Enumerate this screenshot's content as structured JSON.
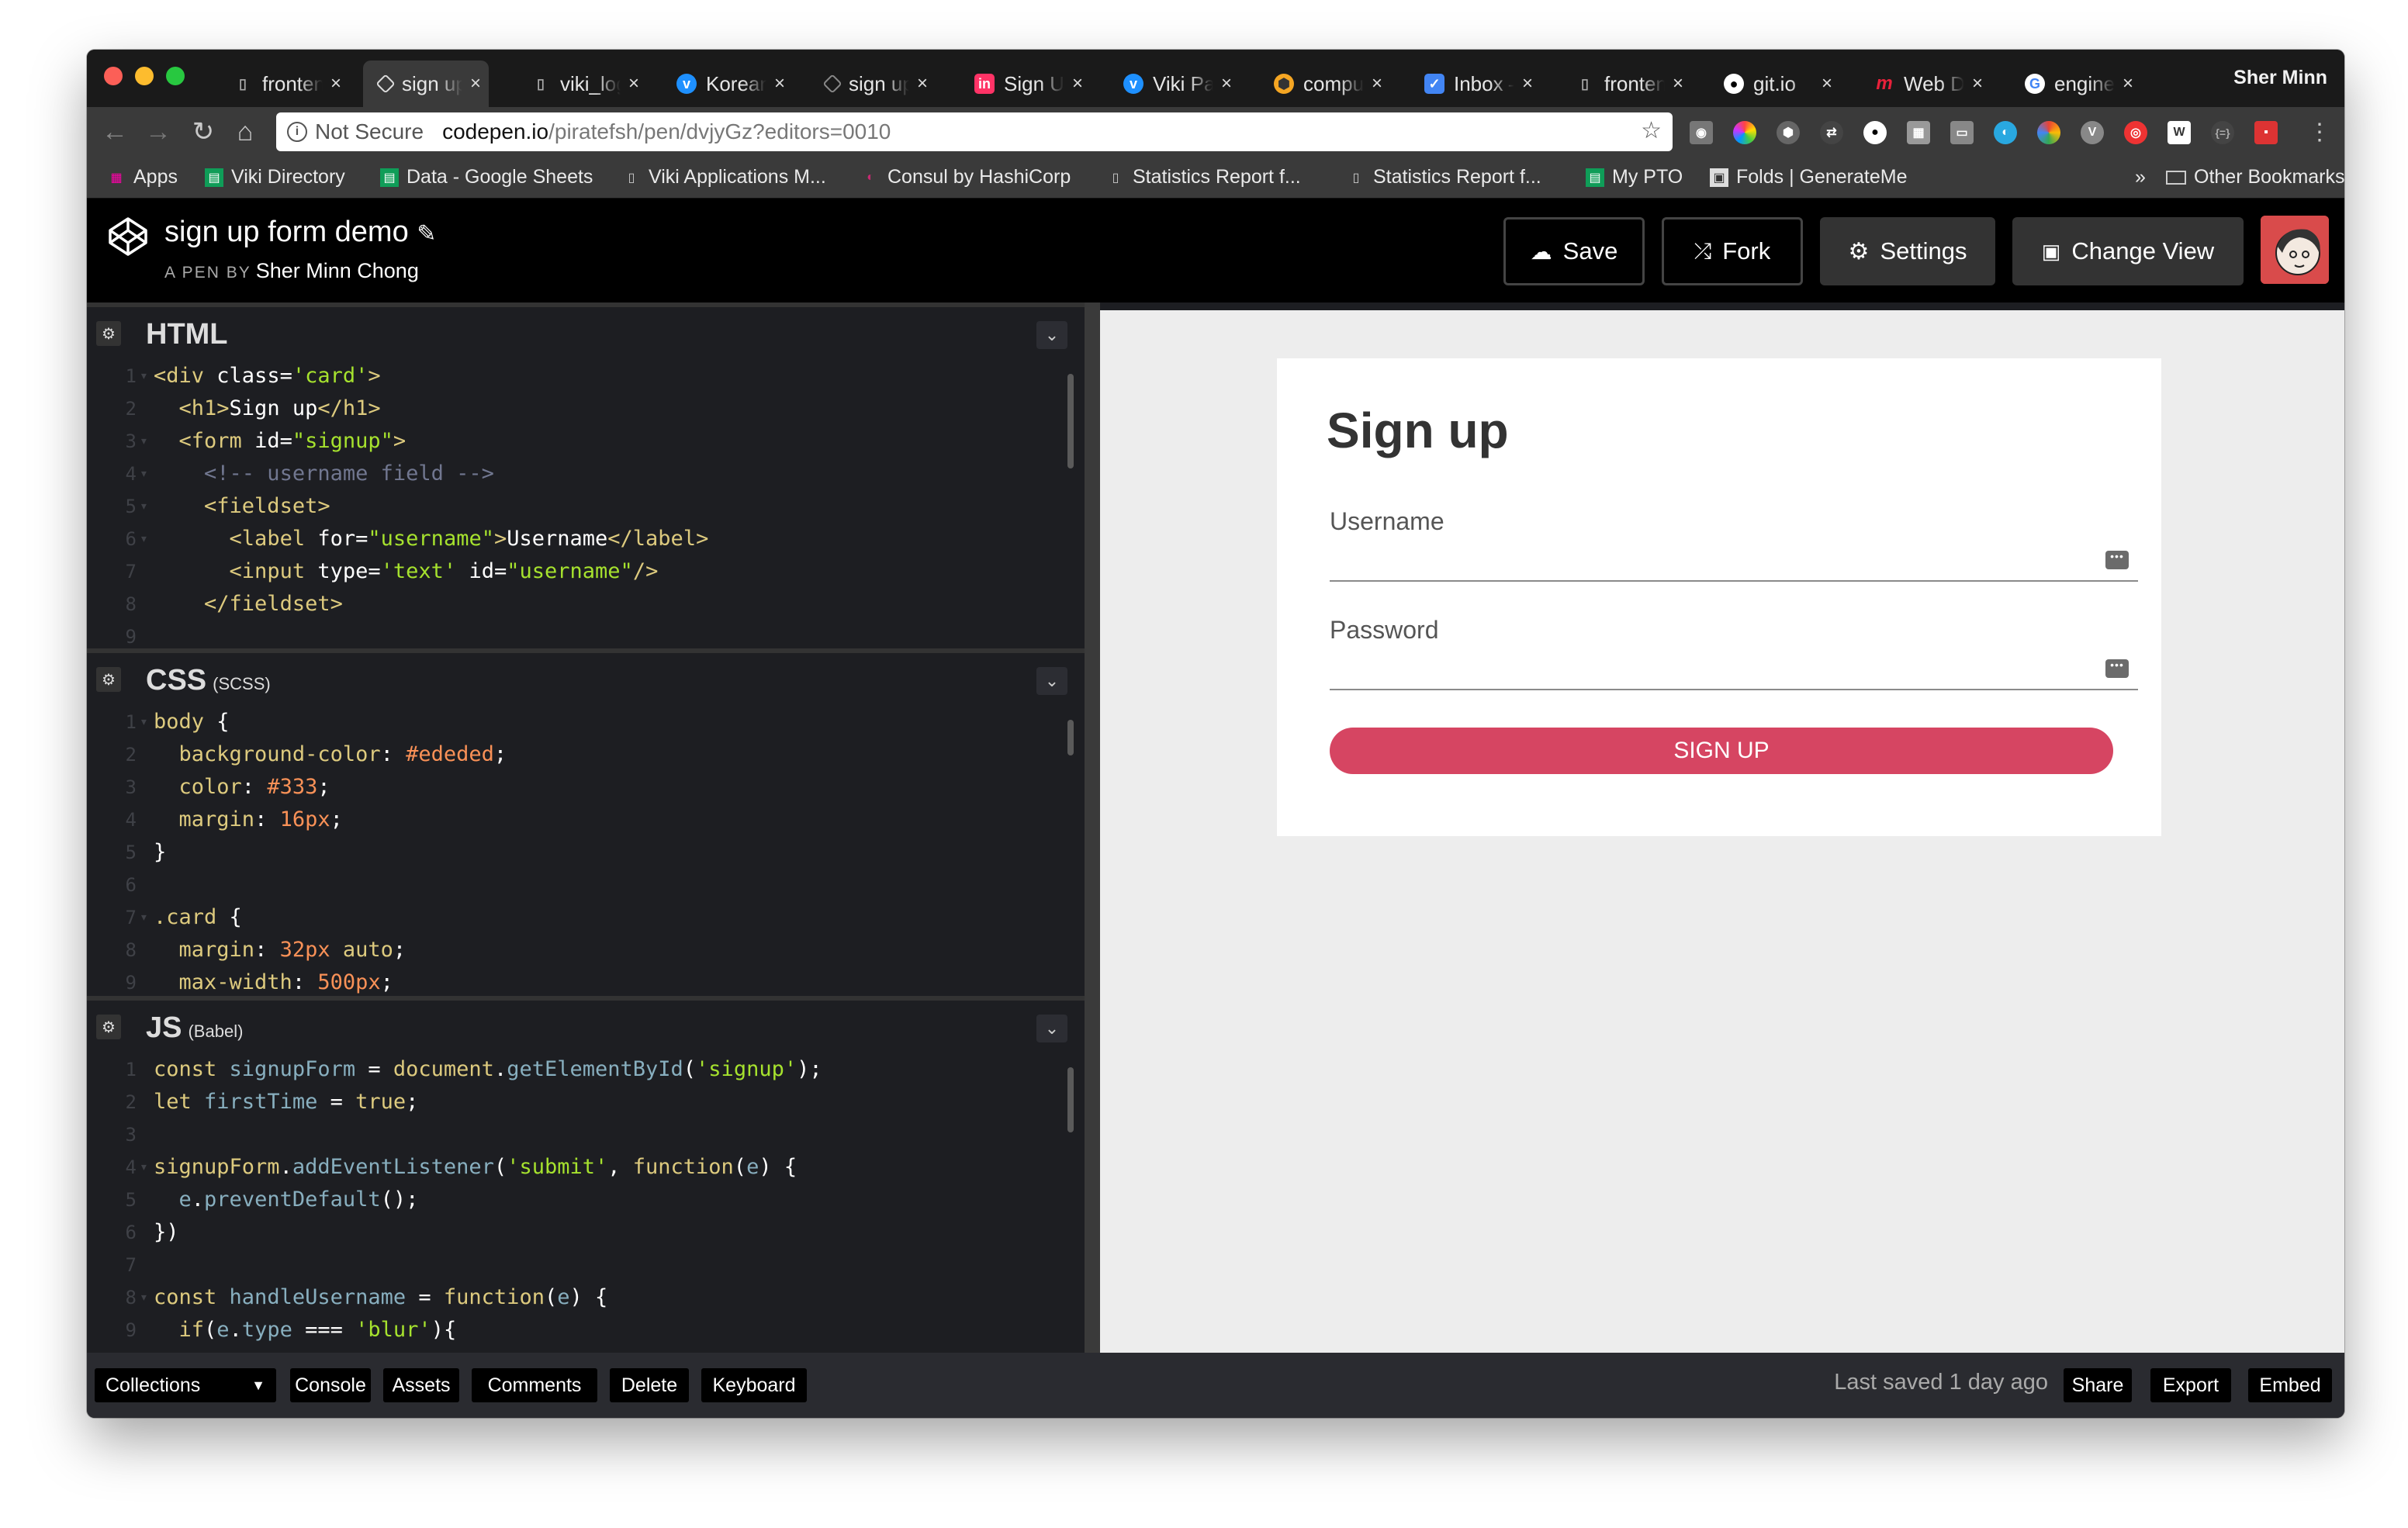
{
  "browser": {
    "tabs": [
      {
        "title": "fronten",
        "icon": "doc-icon"
      },
      {
        "title": "sign up",
        "icon": "codepen-icon"
      },
      {
        "title": "viki_log",
        "icon": "doc-icon"
      },
      {
        "title": "Korean",
        "icon": "viki-icon"
      },
      {
        "title": "sign up",
        "icon": "codepen-icon"
      },
      {
        "title": "Sign Up",
        "icon": "invision-icon"
      },
      {
        "title": "Viki Pa",
        "icon": "viki-icon"
      },
      {
        "title": "comput",
        "icon": "extension-icon"
      },
      {
        "title": "Inbox –",
        "icon": "inbox-icon"
      },
      {
        "title": "fronten",
        "icon": "doc-icon"
      },
      {
        "title": "git.io",
        "icon": "github-icon"
      },
      {
        "title": "Web De",
        "icon": "m-icon"
      },
      {
        "title": "engine",
        "icon": "google-icon"
      }
    ],
    "active_tab_index": 1,
    "profile_name": "Sher Minn",
    "address": {
      "security": "Not Secure",
      "host": "codepen.io",
      "path": "/piratefsh/pen/dvjyGz?editors=0010"
    },
    "bookmarks": [
      {
        "label": "Apps",
        "icon": "apps-grid-icon"
      },
      {
        "label": "Viki Directory",
        "icon": "sheets-icon"
      },
      {
        "label": "Data - Google Sheets",
        "icon": "sheets-icon"
      },
      {
        "label": "Viki Applications M...",
        "icon": "doc-icon"
      },
      {
        "label": "Consul by HashiCorp",
        "icon": "consul-icon"
      },
      {
        "label": "Statistics Report f...",
        "icon": "doc-icon"
      },
      {
        "label": "Statistics Report f...",
        "icon": "doc-icon"
      },
      {
        "label": "My PTO",
        "icon": "sheets-icon"
      },
      {
        "label": "Folds | GenerateMe",
        "icon": "folds-icon"
      }
    ],
    "bookmarks_overflow": "»",
    "other_bookmarks": "Other Bookmarks"
  },
  "codepen": {
    "pen_title": "sign up form demo",
    "by_prefix": "A PEN BY",
    "author": "Sher Minn Chong",
    "buttons": {
      "save": "Save",
      "fork": "Fork",
      "settings": "Settings",
      "change_view": "Change View"
    }
  },
  "editors": {
    "html": {
      "title": "HTML",
      "subtitle": ""
    },
    "css": {
      "title": "CSS",
      "subtitle": "(SCSS)"
    },
    "js": {
      "title": "JS",
      "subtitle": "(Babel)"
    }
  },
  "preview": {
    "heading": "Sign up",
    "username_label": "Username",
    "password_label": "Password",
    "button": "SIGN UP"
  },
  "footer": {
    "collections": "Collections",
    "console": "Console",
    "assets": "Assets",
    "comments": "Comments",
    "delete": "Delete",
    "keyboard": "Keyboard",
    "last_saved": "Last saved 1 day ago",
    "share": "Share",
    "export": "Export",
    "embed": "Embed"
  }
}
